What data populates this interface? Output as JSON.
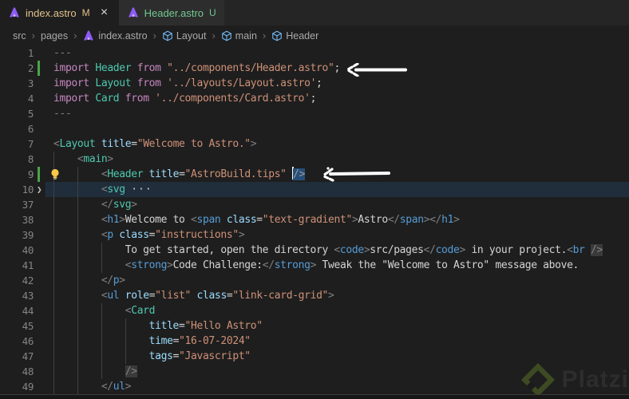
{
  "tabs": [
    {
      "label": "index.astro",
      "badge": "M",
      "status": "modified",
      "active": true,
      "close_glyph": "×"
    },
    {
      "label": "Header.astro",
      "badge": "U",
      "status": "untracked",
      "active": false,
      "close_glyph": ""
    }
  ],
  "breadcrumb": [
    {
      "label": "src",
      "icon": ""
    },
    {
      "label": "pages",
      "icon": ""
    },
    {
      "label": "index.astro",
      "icon": "astro"
    },
    {
      "label": "Layout",
      "icon": "symbol"
    },
    {
      "label": "main",
      "icon": "symbol"
    },
    {
      "label": "Header",
      "icon": "symbol"
    }
  ],
  "breadcrumb_separator": "›",
  "editor": {
    "fold_placeholder": "···",
    "lines": [
      {
        "n": 1,
        "g": 0,
        "t": [
          [
            "punc",
            "---"
          ]
        ]
      },
      {
        "n": 2,
        "g": 0,
        "gut": "mod",
        "t": [
          [
            "kw",
            "import"
          ],
          [
            "txt",
            " "
          ],
          [
            "comp",
            "Header"
          ],
          [
            "txt",
            " "
          ],
          [
            "kw",
            "from"
          ],
          [
            "txt",
            " "
          ],
          [
            "str",
            "\"../components/Header.astro\""
          ],
          [
            "txt",
            ";"
          ]
        ]
      },
      {
        "n": 3,
        "g": 0,
        "t": [
          [
            "kw",
            "import"
          ],
          [
            "txt",
            " "
          ],
          [
            "comp",
            "Layout"
          ],
          [
            "txt",
            " "
          ],
          [
            "kw",
            "from"
          ],
          [
            "txt",
            " "
          ],
          [
            "str",
            "'../layouts/Layout.astro'"
          ],
          [
            "txt",
            ";"
          ]
        ]
      },
      {
        "n": 4,
        "g": 0,
        "t": [
          [
            "kw",
            "import"
          ],
          [
            "txt",
            " "
          ],
          [
            "comp",
            "Card"
          ],
          [
            "txt",
            " "
          ],
          [
            "kw",
            "from"
          ],
          [
            "txt",
            " "
          ],
          [
            "str",
            "'../components/Card.astro'"
          ],
          [
            "txt",
            ";"
          ]
        ]
      },
      {
        "n": 5,
        "g": 0,
        "t": [
          [
            "punc",
            "---"
          ]
        ]
      },
      {
        "n": 6,
        "g": 0,
        "t": []
      },
      {
        "n": 7,
        "g": 0,
        "t": [
          [
            "punc",
            "<"
          ],
          [
            "comp",
            "Layout"
          ],
          [
            "txt",
            " "
          ],
          [
            "attr",
            "title"
          ],
          [
            "txt",
            "="
          ],
          [
            "str",
            "\"Welcome to Astro.\""
          ],
          [
            "punc",
            ">"
          ]
        ]
      },
      {
        "n": 8,
        "g": 1,
        "t": [
          [
            "txt",
            "    "
          ],
          [
            "punc",
            "<"
          ],
          [
            "comp",
            "main"
          ],
          [
            "punc",
            ">"
          ]
        ]
      },
      {
        "n": 9,
        "g": 2,
        "gut": "mod",
        "bulb": true,
        "t": [
          [
            "txt",
            "        "
          ],
          [
            "punc",
            "<"
          ],
          [
            "comp",
            "Header"
          ],
          [
            "txt",
            " "
          ],
          [
            "attr",
            "title"
          ],
          [
            "txt",
            "="
          ],
          [
            "str",
            "\"AstroBuild.tips\""
          ],
          [
            "txt",
            " "
          ],
          [
            "cursor",
            ""
          ],
          [
            "sel",
            "/>"
          ]
        ]
      },
      {
        "n": 10,
        "g": 2,
        "fold": true,
        "hl": true,
        "t": [
          [
            "txt",
            "        "
          ],
          [
            "punc",
            "<"
          ],
          [
            "comp",
            "svg"
          ],
          [
            "txt",
            " "
          ],
          [
            "fold",
            "···"
          ]
        ]
      },
      {
        "n": 37,
        "g": 2,
        "t": [
          [
            "txt",
            "        "
          ],
          [
            "punc",
            "</"
          ],
          [
            "comp",
            "svg"
          ],
          [
            "punc",
            ">"
          ]
        ]
      },
      {
        "n": 38,
        "g": 2,
        "t": [
          [
            "txt",
            "        "
          ],
          [
            "punc",
            "<"
          ],
          [
            "tag",
            "h1"
          ],
          [
            "punc",
            ">"
          ],
          [
            "txt",
            "Welcome to "
          ],
          [
            "punc",
            "<"
          ],
          [
            "tag",
            "span"
          ],
          [
            "txt",
            " "
          ],
          [
            "attr",
            "class"
          ],
          [
            "txt",
            "="
          ],
          [
            "str",
            "\"text-gradient\""
          ],
          [
            "punc",
            ">"
          ],
          [
            "txt",
            "Astro"
          ],
          [
            "punc",
            "</"
          ],
          [
            "tag",
            "span"
          ],
          [
            "punc",
            ">"
          ],
          [
            "punc",
            "</"
          ],
          [
            "tag",
            "h1"
          ],
          [
            "punc",
            ">"
          ]
        ]
      },
      {
        "n": 39,
        "g": 2,
        "t": [
          [
            "txt",
            "        "
          ],
          [
            "punc",
            "<"
          ],
          [
            "tag",
            "p"
          ],
          [
            "txt",
            " "
          ],
          [
            "attr",
            "class"
          ],
          [
            "txt",
            "="
          ],
          [
            "str",
            "\"instructions\""
          ],
          [
            "punc",
            ">"
          ]
        ]
      },
      {
        "n": 40,
        "g": 3,
        "t": [
          [
            "txt",
            "            To get started, open the directory "
          ],
          [
            "punc",
            "<"
          ],
          [
            "tag",
            "code"
          ],
          [
            "punc",
            ">"
          ],
          [
            "txt",
            "src/pages"
          ],
          [
            "punc",
            "</"
          ],
          [
            "tag",
            "code"
          ],
          [
            "punc",
            ">"
          ],
          [
            "txt",
            " in your project."
          ],
          [
            "punc",
            "<"
          ],
          [
            "tag",
            "br"
          ],
          [
            "txt",
            " "
          ],
          [
            "match",
            "/>"
          ]
        ]
      },
      {
        "n": 41,
        "g": 3,
        "t": [
          [
            "txt",
            "            "
          ],
          [
            "punc",
            "<"
          ],
          [
            "tag",
            "strong"
          ],
          [
            "punc",
            ">"
          ],
          [
            "txt",
            "Code Challenge:"
          ],
          [
            "punc",
            "</"
          ],
          [
            "tag",
            "strong"
          ],
          [
            "punc",
            ">"
          ],
          [
            "txt",
            " Tweak the \"Welcome to Astro\" message above."
          ]
        ]
      },
      {
        "n": 42,
        "g": 2,
        "t": [
          [
            "txt",
            "        "
          ],
          [
            "punc",
            "</"
          ],
          [
            "tag",
            "p"
          ],
          [
            "punc",
            ">"
          ]
        ]
      },
      {
        "n": 43,
        "g": 2,
        "t": [
          [
            "txt",
            "        "
          ],
          [
            "punc",
            "<"
          ],
          [
            "tag",
            "ul"
          ],
          [
            "txt",
            " "
          ],
          [
            "attr",
            "role"
          ],
          [
            "txt",
            "="
          ],
          [
            "str",
            "\"list\""
          ],
          [
            "txt",
            " "
          ],
          [
            "attr",
            "class"
          ],
          [
            "txt",
            "="
          ],
          [
            "str",
            "\"link-card-grid\""
          ],
          [
            "punc",
            ">"
          ]
        ]
      },
      {
        "n": 44,
        "g": 3,
        "t": [
          [
            "txt",
            "            "
          ],
          [
            "punc",
            "<"
          ],
          [
            "comp",
            "Card"
          ]
        ]
      },
      {
        "n": 45,
        "g": 4,
        "t": [
          [
            "txt",
            "                "
          ],
          [
            "attr",
            "title"
          ],
          [
            "txt",
            "="
          ],
          [
            "str",
            "\"Hello Astro\""
          ]
        ]
      },
      {
        "n": 46,
        "g": 4,
        "t": [
          [
            "txt",
            "                "
          ],
          [
            "attr",
            "time"
          ],
          [
            "txt",
            "="
          ],
          [
            "str",
            "\"16-07-2024\""
          ]
        ]
      },
      {
        "n": 47,
        "g": 4,
        "t": [
          [
            "txt",
            "                "
          ],
          [
            "attr",
            "tags"
          ],
          [
            "txt",
            "="
          ],
          [
            "str",
            "\"Javascript\""
          ]
        ]
      },
      {
        "n": 48,
        "g": 3,
        "t": [
          [
            "txt",
            "            "
          ],
          [
            "match",
            "/>"
          ]
        ]
      },
      {
        "n": 49,
        "g": 2,
        "t": [
          [
            "txt",
            "        "
          ],
          [
            "punc",
            "</"
          ],
          [
            "tag",
            "ul"
          ],
          [
            "punc",
            ">"
          ]
        ]
      }
    ]
  },
  "watermark": {
    "text": "Platzi"
  },
  "colors": {
    "editor_bg": "#1e1e1e",
    "tabbar_bg": "#252526",
    "inactive_tab_bg": "#2d2d2d",
    "modified_file": "#e2c08d",
    "untracked_file": "#73c991",
    "gutter_added": "#4aa546",
    "selection": "#264f78",
    "fold_highlight_rgba": "rgba(38,79,120,0.32)",
    "keyword": "#c586c0",
    "component_tag": "#4ec9b0",
    "html_tag": "#569cd6",
    "attribute": "#9cdcfe",
    "string": "#ce9178",
    "punctuation": "#808080",
    "plain_text": "#d4d4d4",
    "astro_logo": "#8d5bf4",
    "symbol_icon": "#75beff",
    "annotation_arrow": "#ffffff"
  }
}
